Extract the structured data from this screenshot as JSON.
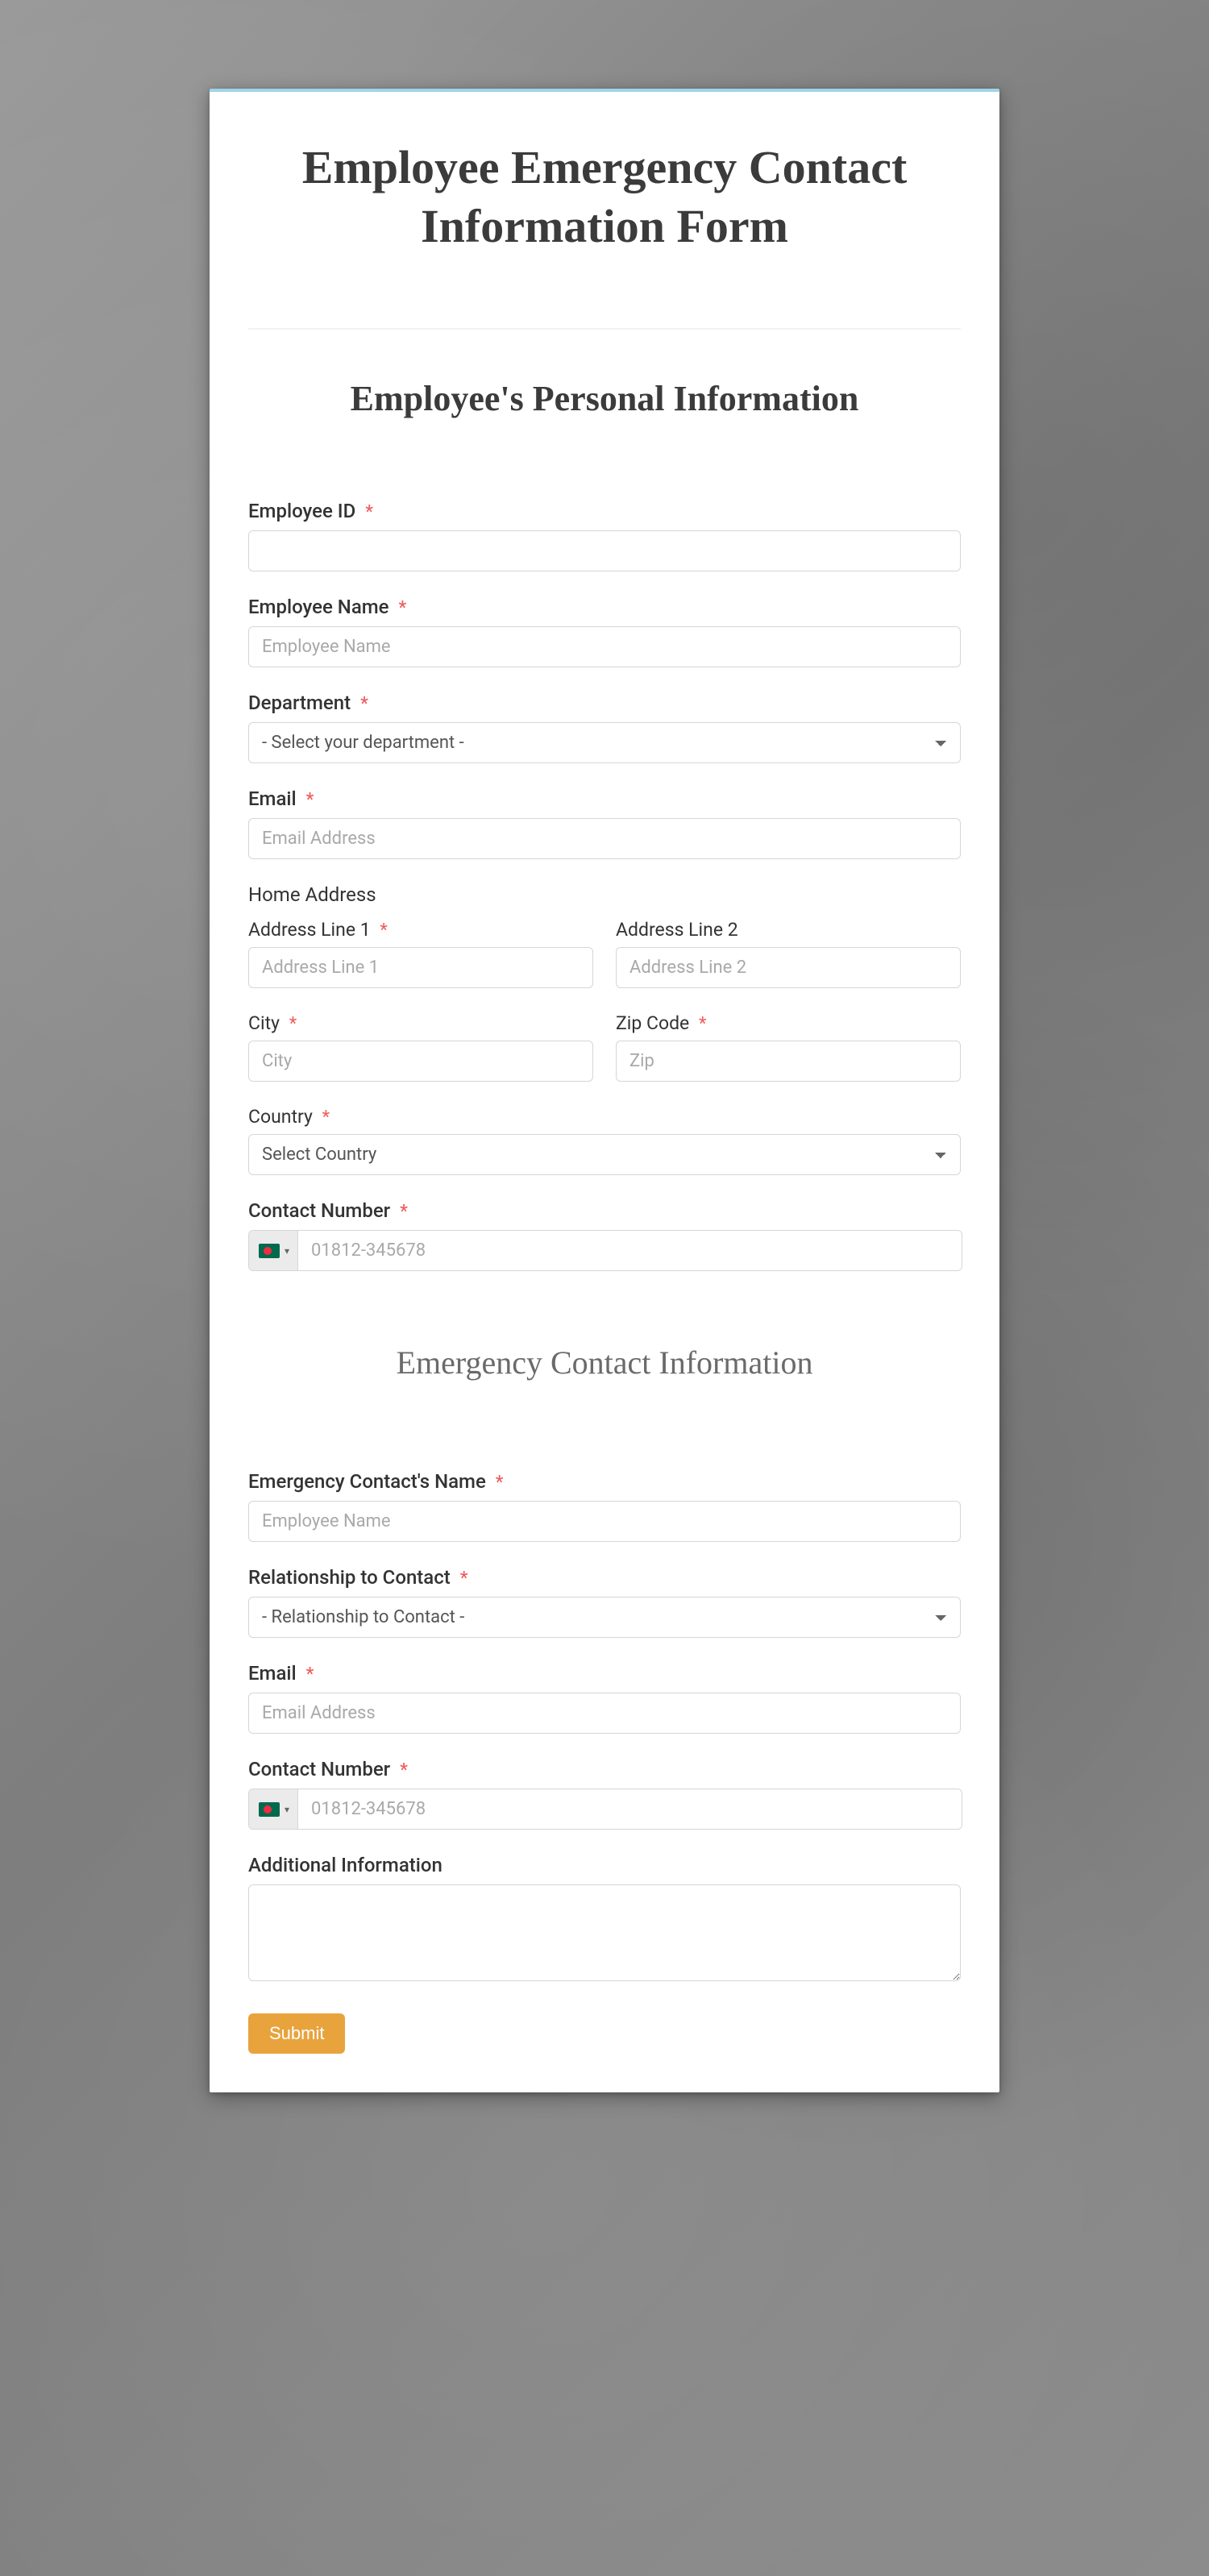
{
  "title": "Employee Emergency Contact Information Form",
  "section1_title": "Employee's Personal Information",
  "section2_title": "Emergency Contact Information",
  "labels": {
    "employee_id": "Employee ID",
    "employee_name": "Employee Name",
    "department": "Department",
    "email": "Email",
    "home_address": "Home Address",
    "address1": "Address Line 1",
    "address2": "Address Line 2",
    "city": "City",
    "zip": "Zip Code",
    "country": "Country",
    "contact_number": "Contact Number",
    "ec_name": "Emergency Contact's Name",
    "relationship": "Relationship to Contact",
    "additional_info": "Additional Information"
  },
  "placeholders": {
    "employee_name": "Employee Name",
    "email": "Email Address",
    "address1": "Address Line 1",
    "address2": "Address Line 2",
    "city": "City",
    "zip": "Zip",
    "phone": "01812-345678",
    "ec_name": "Employee Name"
  },
  "select_options": {
    "department": "- Select your department -",
    "country": "Select Country",
    "relationship": "- Relationship to Contact -"
  },
  "submit_label": "Submit",
  "required_marker": "*",
  "phone_country_flag": "bangladesh"
}
